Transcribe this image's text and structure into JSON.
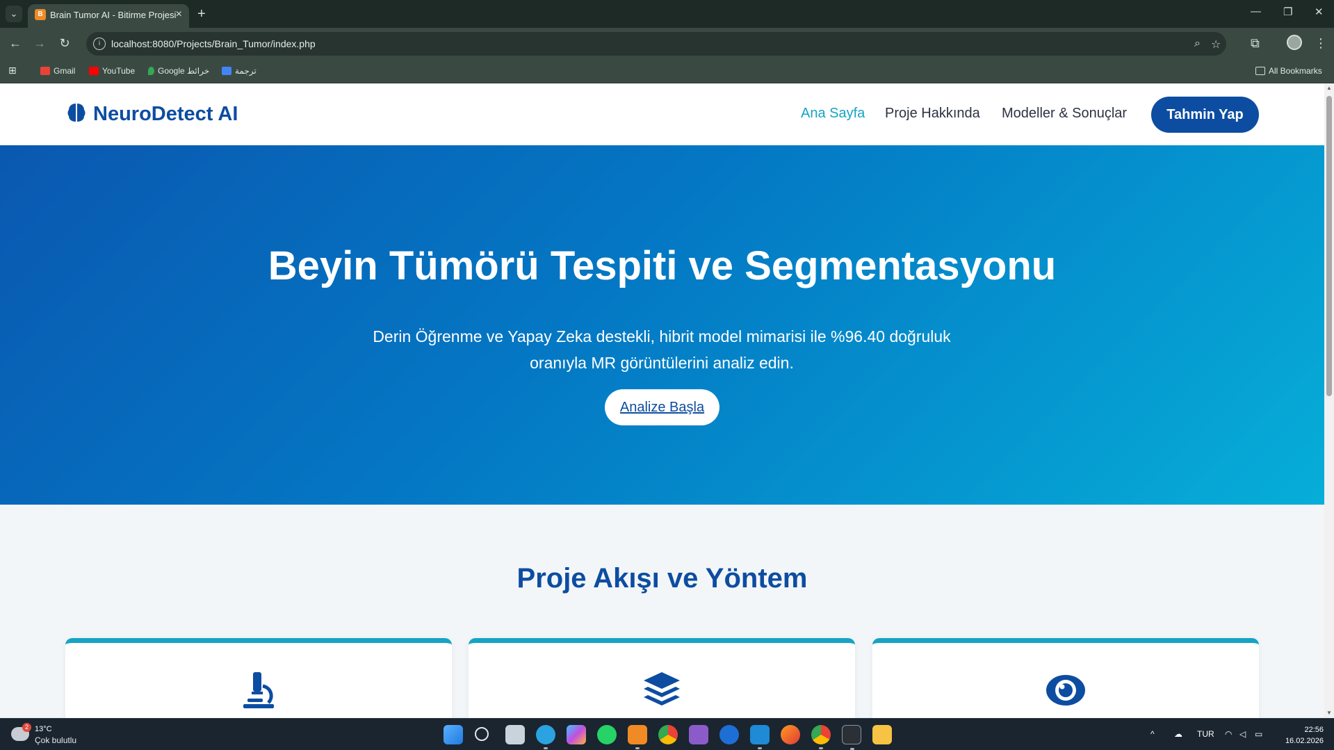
{
  "browser": {
    "tab_title": "Brain Tumor AI - Bitirme Projesi",
    "url": "localhost:8080/Projects/Brain_Tumor/index.php",
    "bookmarks": [
      {
        "label": "Gmail",
        "color": "#ea4335"
      },
      {
        "label": "YouTube",
        "color": "#ff0000"
      },
      {
        "label": "Google خرائط",
        "color": "#34a853"
      },
      {
        "label": "ترجمة",
        "color": "#4285f4"
      }
    ],
    "all_bookmarks_label": "All Bookmarks"
  },
  "site": {
    "brand": "NeuroDetect AI",
    "nav": {
      "home": "Ana Sayfa",
      "about": "Proje Hakkında",
      "models": "Modeller & Sonuçlar",
      "cta": "Tahmin Yap"
    },
    "hero": {
      "title": "Beyin Tümörü Tespiti ve Segmentasyonu",
      "subtitle": "Derin Öğrenme ve Yapay Zeka destekli, hibrit model mimarisi ile %96.40 doğruluk oranıyla MR görüntülerini analiz edin.",
      "button": "Analize Başla"
    },
    "section": {
      "title": "Proje Akışı ve Yöntem",
      "cards": [
        {
          "icon": "microscope-icon"
        },
        {
          "icon": "layers-icon"
        },
        {
          "icon": "eye-icon"
        }
      ]
    },
    "colors": {
      "primary": "#0d4da1",
      "accent": "#16a3c4",
      "hero_start": "#0a58b0",
      "hero_end": "#06aed8"
    }
  },
  "taskbar": {
    "weather_temp": "13°C",
    "weather_desc": "Çok bulutlu",
    "weather_badge": "2",
    "language": "TUR",
    "time": "22:56",
    "date": "16.02.2026"
  }
}
